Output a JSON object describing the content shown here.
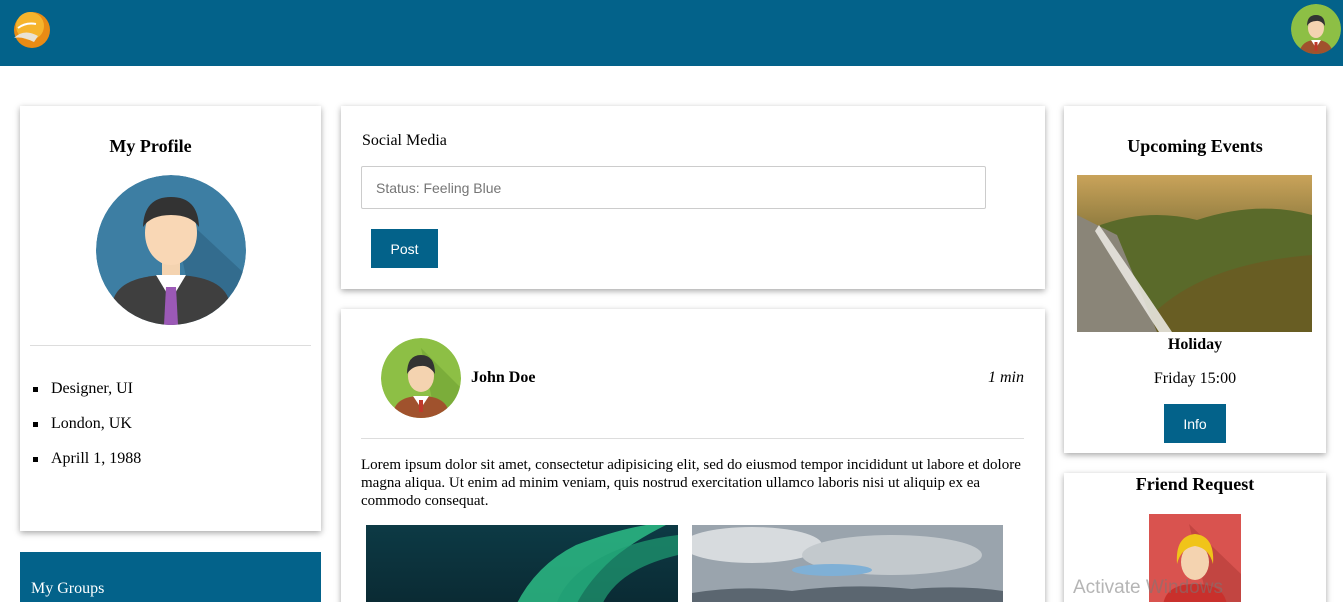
{
  "header": {
    "logo_icon": "app-logo-icon",
    "user_avatar_icon": "user-avatar-icon",
    "bar_color": "#03628a"
  },
  "profile": {
    "title": "My Profile",
    "details": [
      "Designer, UI",
      "London, UK",
      "Aprill 1, 1988"
    ]
  },
  "groups": {
    "label": "My Groups"
  },
  "social": {
    "label": "Social Media",
    "status_placeholder": "Status: Feeling Blue",
    "post_label": "Post"
  },
  "post": {
    "author": "John Doe",
    "time": "1 min",
    "body": "Lorem ipsum dolor sit amet, consectetur adipisicing elit, sed do eiusmod tempor incididunt ut labore et dolore magna aliqua. Ut enim ad minim veniam, quis nostrud exercitation ullamco laboris nisi ut aliquip ex ea commodo consequat."
  },
  "events": {
    "title": "Upcoming Events",
    "event_name": "Holiday",
    "event_time": "Friday 15:00",
    "info_label": "Info"
  },
  "friends": {
    "title": "Friend Request"
  },
  "system": {
    "watermark": "Activate Windows"
  }
}
